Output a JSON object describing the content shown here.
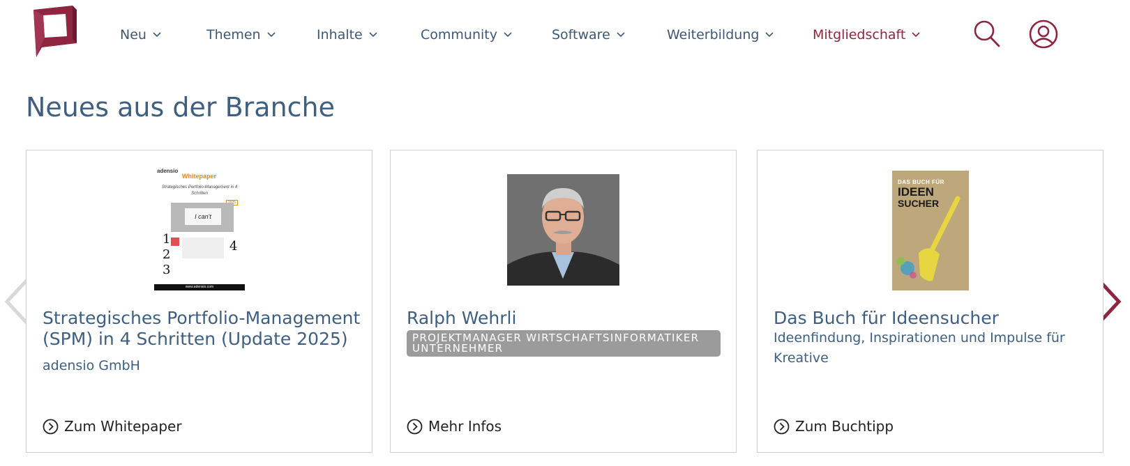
{
  "colors": {
    "brand": "#8e2640",
    "nav_text": "#3e5874",
    "heading": "#3f5f80",
    "badge_bg": "#9b9b9b"
  },
  "header": {
    "logo_icon": "site-logo",
    "nav": [
      {
        "label": "Neu"
      },
      {
        "label": "Themen"
      },
      {
        "label": "Inhalte"
      },
      {
        "label": "Community"
      },
      {
        "label": "Software"
      },
      {
        "label": "Weiterbildung"
      },
      {
        "label": "Mitgliedschaft"
      }
    ],
    "search_icon": "search-icon",
    "user_icon": "user-circle-icon"
  },
  "section": {
    "title": "Neues aus der Branche",
    "cards": [
      {
        "title": "Strategisches Portfolio-Management (SPM) in 4 Schritten (Update 2025)",
        "subtitle": "adensio GmbH",
        "link": "Zum Whitepaper",
        "image": {
          "brand": "adensio",
          "tag": "Whitepaper",
          "heading": "Strategisches Portfolio-Management in 4 Schritten",
          "year": "2025",
          "note": "I can't",
          "footer": "www.adensio.com"
        }
      },
      {
        "title": "Ralph Wehrli",
        "badge": "PROJEKTMANAGER WIRTSCHAFTSINFORMATIKER UNTERNEHMER",
        "link": "Mehr Infos"
      },
      {
        "title": "Das Buch für Ideensucher",
        "subtitle": "Ideenfindung, Inspirationen und Impulse für Kreative",
        "link": "Zum Buchtipp",
        "image": {
          "line1": "DAS BUCH FÜR",
          "line2": "IDEEN",
          "line3": "SUCHER"
        }
      }
    ]
  }
}
